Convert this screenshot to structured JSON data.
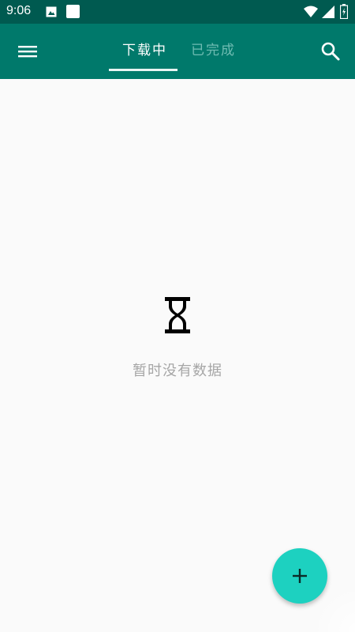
{
  "status_bar": {
    "time": "9:06",
    "icons": [
      "gallery-icon",
      "notification-square-icon",
      "wifi-icon",
      "signal-icon",
      "battery-icon"
    ]
  },
  "app_bar": {
    "menu_icon": "menu-icon",
    "search_icon": "search-icon",
    "tabs": [
      {
        "label": "下载中",
        "selected": true
      },
      {
        "label": "已完成",
        "selected": false
      }
    ],
    "colors": {
      "status_bar": "#005a50",
      "app_bar": "#00796b",
      "fab": "#1dd1c0"
    }
  },
  "empty_state": {
    "icon": "hourglass-icon",
    "message": "暂时没有数据"
  },
  "fab": {
    "icon": "plus-icon"
  }
}
